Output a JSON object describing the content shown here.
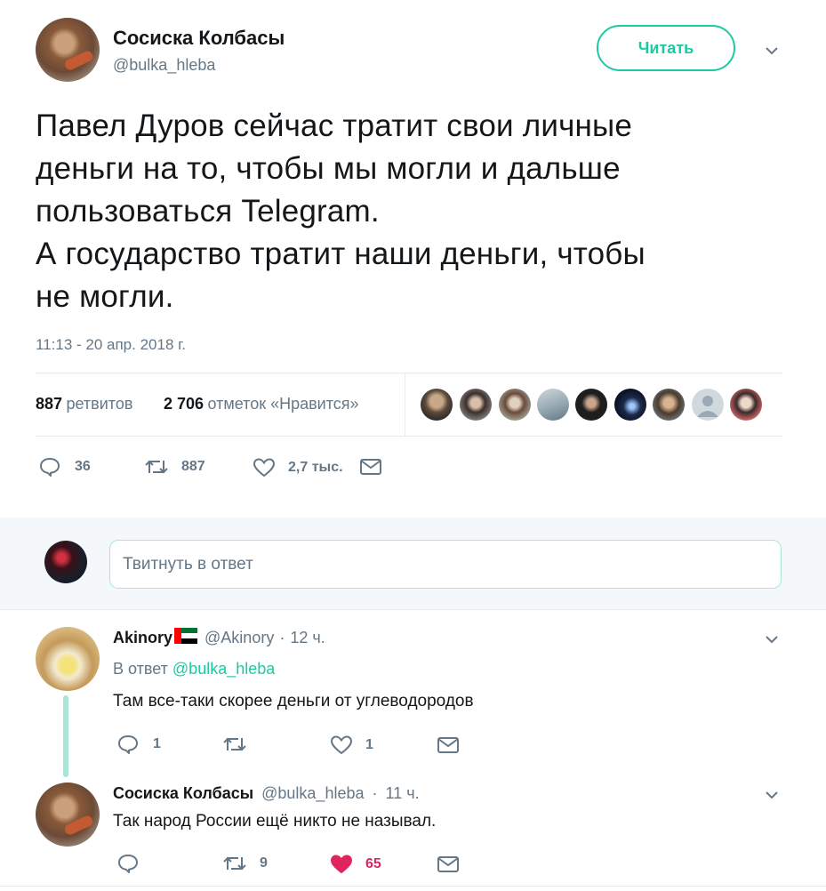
{
  "main_tweet": {
    "author_name": "Сосиска Колбасы",
    "author_handle": "@bulka_hleba",
    "follow_label": "Читать",
    "text_lines": [
      "Павел Дуров сейчас тратит свои личные",
      "деньги на то, чтобы мы могли и дальше",
      "пользоваться Telegram.",
      "А государство тратит наши деньги, чтобы",
      "не могли."
    ],
    "timestamp": "11:13 - 20 апр. 2018 г.",
    "retweets_count": "887",
    "retweets_label": "ретвитов",
    "likes_count": "2 706",
    "likes_label": "отметок «Нравится»",
    "actions": {
      "replies": "36",
      "retweets": "887",
      "likes": "2,7 тыс."
    },
    "liker_avatars": [
      "avatar-1",
      "avatar-2",
      "avatar-3",
      "avatar-4",
      "avatar-5",
      "avatar-6",
      "avatar-7",
      "avatar-8",
      "avatar-9"
    ]
  },
  "reply_composer": {
    "placeholder": "Твитнуть в ответ"
  },
  "replies": [
    {
      "author_name": "Akinory",
      "flag_icon": "uae-flag-icon",
      "author_handle": "@Akinory",
      "separator": "·",
      "time": "12 ч.",
      "in_reply_prefix": "В ответ",
      "in_reply_handle": "@bulka_hleba",
      "text": "Там все-таки скорее деньги от углеводородов",
      "replies_count": "1",
      "retweets_count": "",
      "likes_count": "1"
    },
    {
      "author_name": "Сосиска Колбасы",
      "author_handle": "@bulka_hleba",
      "separator": "·",
      "time": "11 ч.",
      "text": "Так народ России ещё никто не называл.",
      "replies_count": "",
      "retweets_count": "9",
      "likes_count": "65",
      "liked": true
    }
  ],
  "colors": {
    "accent": "#1dcaa0",
    "like_active": "#e0245e",
    "secondary_text": "#657786"
  }
}
